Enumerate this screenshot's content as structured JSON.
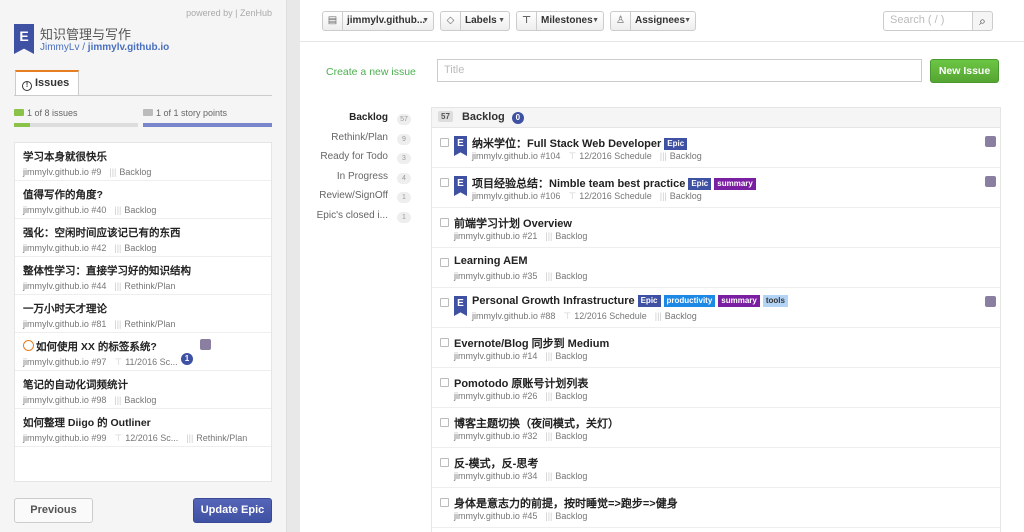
{
  "powered_by": "powered by | ZenHub",
  "epic": {
    "logo_letter": "E",
    "title": "知识管理与写作",
    "owner": "JimmyLv",
    "separator": " / ",
    "repo": "jimmylv.github.io"
  },
  "tabs": {
    "issues_label": "Issues"
  },
  "progress": {
    "issues_text": "1 of 8 issues",
    "issues_fraction": 0.125,
    "points_text": "1 of 1 story points",
    "points_fraction": 1.0
  },
  "left_issues": [
    {
      "title": "学习本身就很快乐",
      "repo_num": "jimmylv.github.io #9",
      "pipeline": "Backlog"
    },
    {
      "title": "值得写作的角度?",
      "repo_num": "jimmylv.github.io #40",
      "pipeline": "Backlog"
    },
    {
      "title": "强化：空闲时间应该记已有的东西",
      "repo_num": "jimmylv.github.io #42",
      "pipeline": "Backlog"
    },
    {
      "title": "整体性学习：直接学习好的知识结构",
      "repo_num": "jimmylv.github.io #44",
      "pipeline": "Rethink/Plan"
    },
    {
      "title": "一万小时天才理论",
      "repo_num": "jimmylv.github.io #81",
      "pipeline": "Rethink/Plan"
    },
    {
      "title": "如何使用 XX 的标签系统?",
      "repo_num": "jimmylv.github.io #97",
      "milestone": "11/2016 Sc...",
      "estimate": "1"
    },
    {
      "title": "笔记的自动化词频统计",
      "repo_num": "jimmylv.github.io #98",
      "pipeline": "Backlog"
    },
    {
      "title": "如何整理 Diigo 的 Outliner",
      "repo_num": "jimmylv.github.io #99",
      "milestone": "12/2016 Sc...",
      "pipeline": "Rethink/Plan"
    }
  ],
  "buttons": {
    "previous": "Previous",
    "update": "Update Epic"
  },
  "toolbar": {
    "repo": "jimmylv.github...",
    "labels": "Labels",
    "milestones": "Milestones",
    "assignees": "Assignees",
    "search_placeholder": "Search ( / )"
  },
  "create": {
    "link": "Create a new issue",
    "title_placeholder": "Title",
    "new_issue": "New Issue"
  },
  "pipelines": [
    {
      "name": "Backlog",
      "count": "57"
    },
    {
      "name": "Rethink/Plan",
      "count": "9"
    },
    {
      "name": "Ready for Todo",
      "count": "3"
    },
    {
      "name": "In Progress",
      "count": "4"
    },
    {
      "name": "Review/SignOff",
      "count": "1"
    },
    {
      "name": "Epic's closed i...",
      "count": "1"
    }
  ],
  "board": {
    "count": "57",
    "name": "Backlog",
    "badge": "0",
    "cards": [
      {
        "title": "纳米学位：Full Stack Web Developer",
        "repo_num": "jimmylv.github.io #104",
        "milestone": "12/2016 Schedule",
        "pipeline": "Backlog",
        "labels": [
          "Epic"
        ]
      },
      {
        "title": "项目经验总结：Nimble team best practice",
        "repo_num": "jimmylv.github.io #106",
        "milestone": "12/2016 Schedule",
        "pipeline": "Backlog",
        "labels": [
          "Epic",
          "summary"
        ]
      },
      {
        "title": "前端学习计划 Overview",
        "repo_num": "jimmylv.github.io #21",
        "pipeline": "Backlog",
        "labels": []
      },
      {
        "title": "Learning AEM",
        "repo_num": "jimmylv.github.io #35",
        "pipeline": "Backlog",
        "labels": []
      },
      {
        "title": "Personal Growth Infrastructure",
        "repo_num": "jimmylv.github.io #88",
        "milestone": "12/2016 Schedule",
        "pipeline": "Backlog",
        "labels": [
          "Epic",
          "productivity",
          "summary",
          "tools"
        ]
      },
      {
        "title": "Evernote/Blog 同步到 Medium",
        "repo_num": "jimmylv.github.io #14",
        "pipeline": "Backlog",
        "labels": []
      },
      {
        "title": "Pomotodo 原账号计划列表",
        "repo_num": "jimmylv.github.io #26",
        "pipeline": "Backlog",
        "labels": []
      },
      {
        "title": "博客主题切换（夜间模式，关灯）",
        "repo_num": "jimmylv.github.io #32",
        "pipeline": "Backlog",
        "labels": []
      },
      {
        "title": "反-模式，反-思考",
        "repo_num": "jimmylv.github.io #34",
        "pipeline": "Backlog",
        "labels": []
      },
      {
        "title": "身体是意志力的前提，按时睡觉=>跑步=>健身",
        "repo_num": "jimmylv.github.io #45",
        "pipeline": "Backlog",
        "labels": []
      }
    ]
  },
  "colors": {
    "epic": "#3f51a3",
    "accent": "#e67e22",
    "green": "#55a532",
    "summary": "#7b1fa2",
    "productivity": "#1e88e5",
    "tools": "#b3d4f5"
  }
}
